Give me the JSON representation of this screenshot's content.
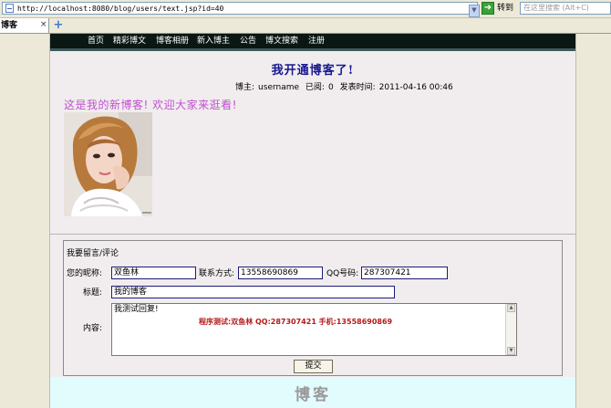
{
  "browser": {
    "url": "http://localhost:8080/blog/users/text.jsp?id=40",
    "go_label": "转到",
    "search_placeholder": "在这里搜索 (Alt+C)",
    "tab_title": "博客",
    "tab_close": "×",
    "new_tab": "+"
  },
  "nav": {
    "items": [
      "首页",
      "精彩博文",
      "博客相册",
      "新入博主",
      "公告",
      "博文搜索",
      "注册"
    ]
  },
  "post": {
    "title": "我开通博客了!",
    "author_label": "博主:",
    "author": "username",
    "views_label": "已阅:",
    "views": "0",
    "time_label": "发表时间:",
    "time": "2011-04-16 00:46",
    "body": "这是我的新博客!   欢迎大家来逛看!"
  },
  "comment_form": {
    "heading": "我要留言/评论",
    "nickname_label": "您的昵称:",
    "nickname_value": "双鱼林",
    "contact_label": "联系方式:",
    "contact_value": "13558690869",
    "qq_label": "QQ号码:",
    "qq_value": "287307421",
    "subject_label": "标题:",
    "subject_value": "我的博客",
    "content_label": "内容:",
    "content_value": "我测试回复!",
    "content_signature": "程序测试:双鱼林 QQ:287307421 手机:13558690869",
    "submit_label": "提交"
  },
  "footer": {
    "text": "博客"
  },
  "colors": {
    "title": "#17178f",
    "body_text": "#c050d0",
    "navbar": "#0a1712",
    "signature": "#b51a1a",
    "footer_band": "#e2fbfd"
  }
}
